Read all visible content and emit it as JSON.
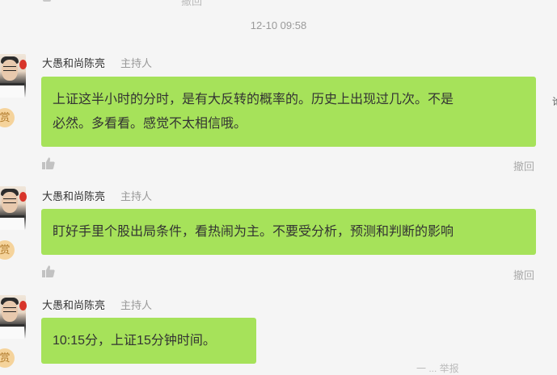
{
  "timestamp": "12-10 09:58",
  "top_revoke": "撤回",
  "badge_label": "赏",
  "messages": [
    {
      "author": "大愚和尚陈亮",
      "role": "主持人",
      "text_lines": [
        "上证这半小时的分时，是有大反转的概率的。历史上出现过几次。不是",
        "必然。多看看。感觉不太相信哦。"
      ],
      "revoke": "撤回"
    },
    {
      "author": "大愚和尚陈亮",
      "role": "主持人",
      "text_lines": [
        "盯好手里个股出局条件，看热闹为主。不要受分析，预测和判断的影响"
      ],
      "revoke": "撤回"
    },
    {
      "author": "大愚和尚陈亮",
      "role": "主持人",
      "text_lines": [
        "10:15分，上证15分钟时间。"
      ],
      "revoke": ""
    }
  ],
  "edge_text": [
    "（",
    "论"
  ],
  "bottom_faint": "一 ... 举报"
}
